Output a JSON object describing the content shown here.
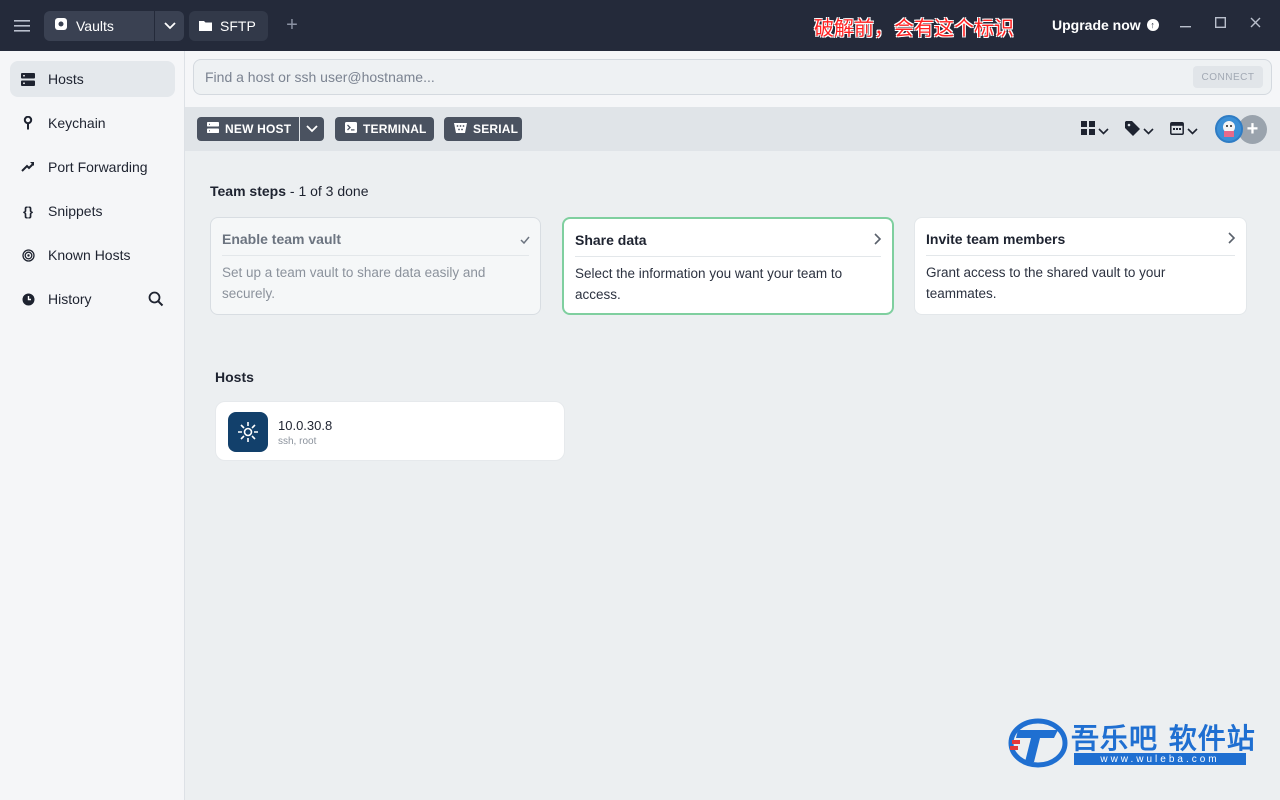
{
  "titlebar": {
    "vault_tab_label": "Vaults",
    "sftp_tab_label": "SFTP",
    "watermark_text": "破解前，会有这个标识",
    "upgrade_label": "Upgrade now"
  },
  "sidebar": {
    "items": [
      {
        "label": "Hosts",
        "icon": "hosts-icon"
      },
      {
        "label": "Keychain",
        "icon": "key-icon"
      },
      {
        "label": "Port Forwarding",
        "icon": "port-forward-icon"
      },
      {
        "label": "Snippets",
        "icon": "braces-icon"
      },
      {
        "label": "Known Hosts",
        "icon": "fingerprint-icon"
      },
      {
        "label": "History",
        "icon": "clock-icon"
      }
    ]
  },
  "search": {
    "placeholder": "Find a host or ssh user@hostname...",
    "connect_label": "CONNECT"
  },
  "toolbar": {
    "new_host_label": "NEW HOST",
    "terminal_label": "TERMINAL",
    "serial_label": "SERIAL"
  },
  "team_steps": {
    "title": "Team steps",
    "progress": "- 1 of 3 done",
    "cards": [
      {
        "title": "Enable team vault",
        "description": "Set up a team vault to share data easily and securely.",
        "state": "done"
      },
      {
        "title": "Share data",
        "description": "Select the information you want your team to access.",
        "state": "active"
      },
      {
        "title": "Invite team members",
        "description": "Grant access to the shared vault to your teammates.",
        "state": "pending"
      }
    ]
  },
  "hosts": {
    "title": "Hosts",
    "items": [
      {
        "name": "10.0.30.8",
        "details": "ssh, root"
      }
    ]
  },
  "site_watermark": {
    "text": "吾乐吧 软件站",
    "url": "www.wuleba.com"
  },
  "colors": {
    "titlebar_bg": "#242a3a",
    "button_bg": "#4a5260",
    "active_card_border": "#7fcf9f",
    "host_icon_bg": "#12406b"
  }
}
